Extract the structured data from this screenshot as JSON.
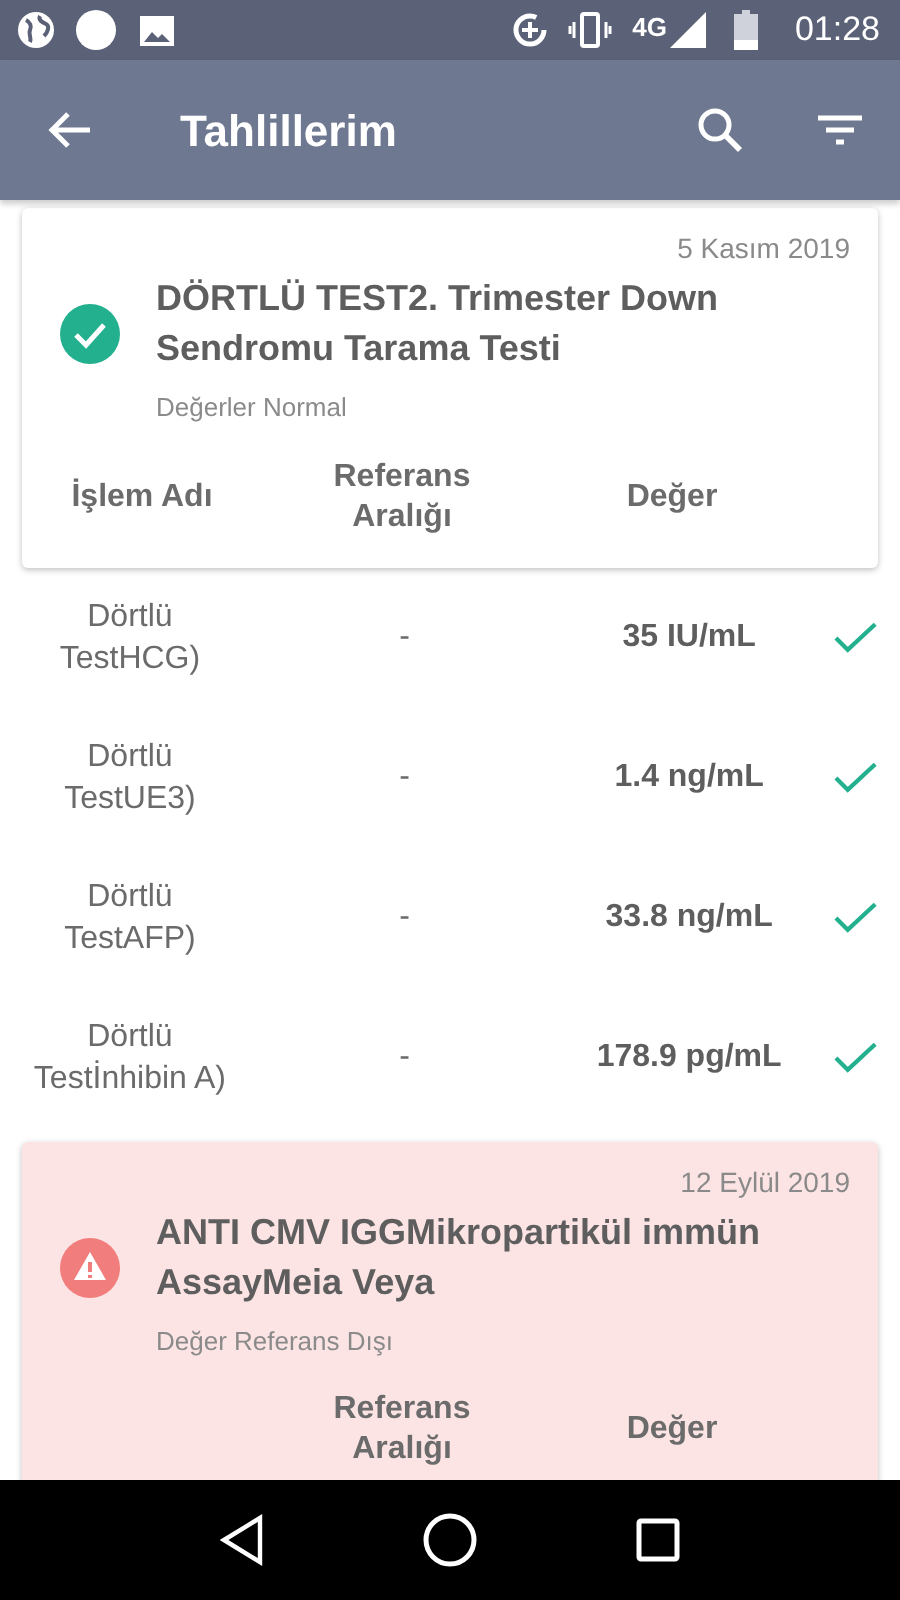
{
  "status_bar": {
    "time": "01:28",
    "network": "4G"
  },
  "app_bar": {
    "title": "Tahlillerim"
  },
  "results": [
    {
      "kind": "normal",
      "date": "5 Kasım 2019",
      "title": "DÖRTLÜ TEST2. Trimester Down Sendromu Tarama Testi",
      "status": "Değerler Normal",
      "headers": {
        "name": "İşlem Adı",
        "range": "Referans Aralığı",
        "value": "Değer"
      },
      "rows": [
        {
          "name": "Dörtlü TestHCG)",
          "range": "-",
          "value": "35 IU/mL",
          "ok": true
        },
        {
          "name": "Dörtlü TestUE3)",
          "range": "-",
          "value": "1.4 ng/mL",
          "ok": true
        },
        {
          "name": "Dörtlü TestAFP)",
          "range": "-",
          "value": "33.8 ng/mL",
          "ok": true
        },
        {
          "name": "Dörtlü Testİnhibin A)",
          "range": "-",
          "value": "178.9 pg/mL",
          "ok": true
        }
      ]
    },
    {
      "kind": "abnormal",
      "date": "12 Eylül 2019",
      "title": "ANTI CMV IGGMikropartikül immün AssayMeia Veya",
      "status": "Değer Referans Dışı",
      "headers": {
        "range": "Referans Aralığı",
        "value": "Değer"
      }
    }
  ]
}
